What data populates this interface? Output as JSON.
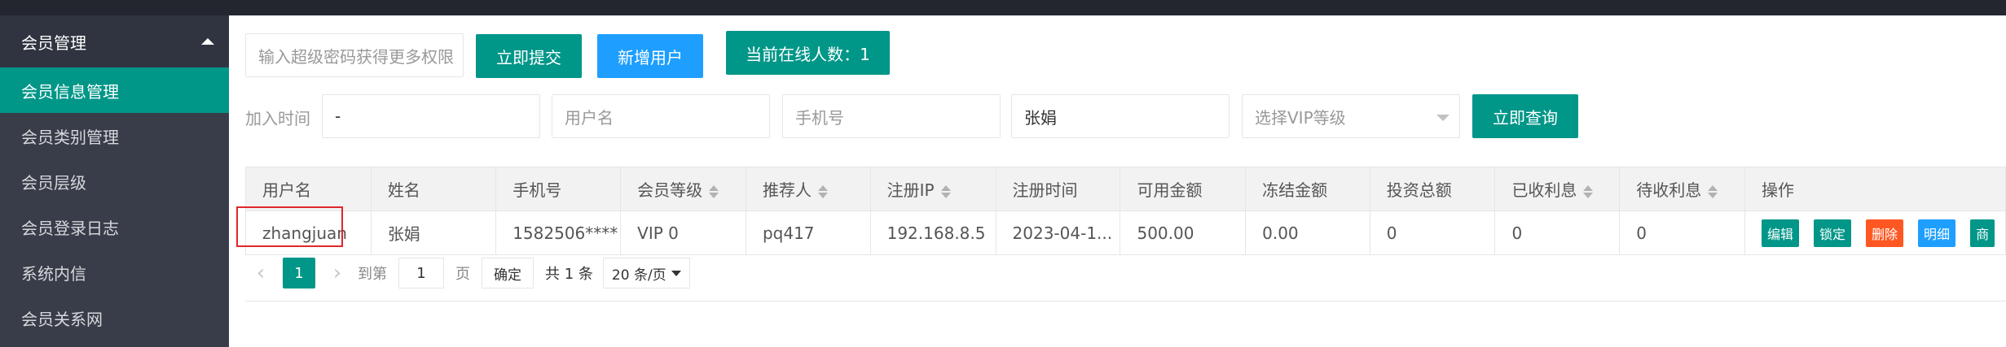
{
  "sidebar": {
    "group_label": "会员管理",
    "items": [
      {
        "label": "会员信息管理"
      },
      {
        "label": "会员类别管理"
      },
      {
        "label": "会员层级"
      },
      {
        "label": "会员登录日志"
      },
      {
        "label": "系统内信"
      },
      {
        "label": "会员关系网"
      }
    ]
  },
  "toolbar": {
    "password_placeholder": "输入超级密码获得更多权限",
    "submit_label": "立即提交",
    "add_user_label": "新增用户",
    "online_label": "当前在线人数：1"
  },
  "filters": {
    "join_time_label": "加入时间",
    "join_time_value": "-",
    "username_placeholder": "用户名",
    "phone_placeholder": "手机号",
    "name_value": "张娟",
    "vip_placeholder": "选择VIP等级",
    "query_label": "立即查询"
  },
  "table": {
    "headers": [
      "用户名",
      "姓名",
      "手机号",
      "会员等级",
      "推荐人",
      "注册IP",
      "注册时间",
      "可用金额",
      "冻结金额",
      "投资总额",
      "已收利息",
      "待收利息",
      "操作"
    ],
    "rows": [
      {
        "cells": [
          "zhangjuan",
          "张娟",
          "1582506****",
          "VIP 0",
          "pq417",
          "192.168.8.5",
          "2023-04-1...",
          "500.00",
          "0.00",
          "0",
          "0",
          "0"
        ],
        "actions": [
          "编辑",
          "锁定",
          "删除",
          "明细",
          "商"
        ]
      }
    ]
  },
  "pager": {
    "current_page": "1",
    "goto_label": "到第",
    "goto_value": "1",
    "page_suffix": "页",
    "confirm_label": "确定",
    "total_label": "共 1 条",
    "page_size_label": "20 条/页"
  },
  "colors": {
    "primary": "#009688",
    "blue": "#1e9fff",
    "danger": "#ff5722",
    "sidebar_bg": "#393d49",
    "highlight": "#e0262a"
  }
}
